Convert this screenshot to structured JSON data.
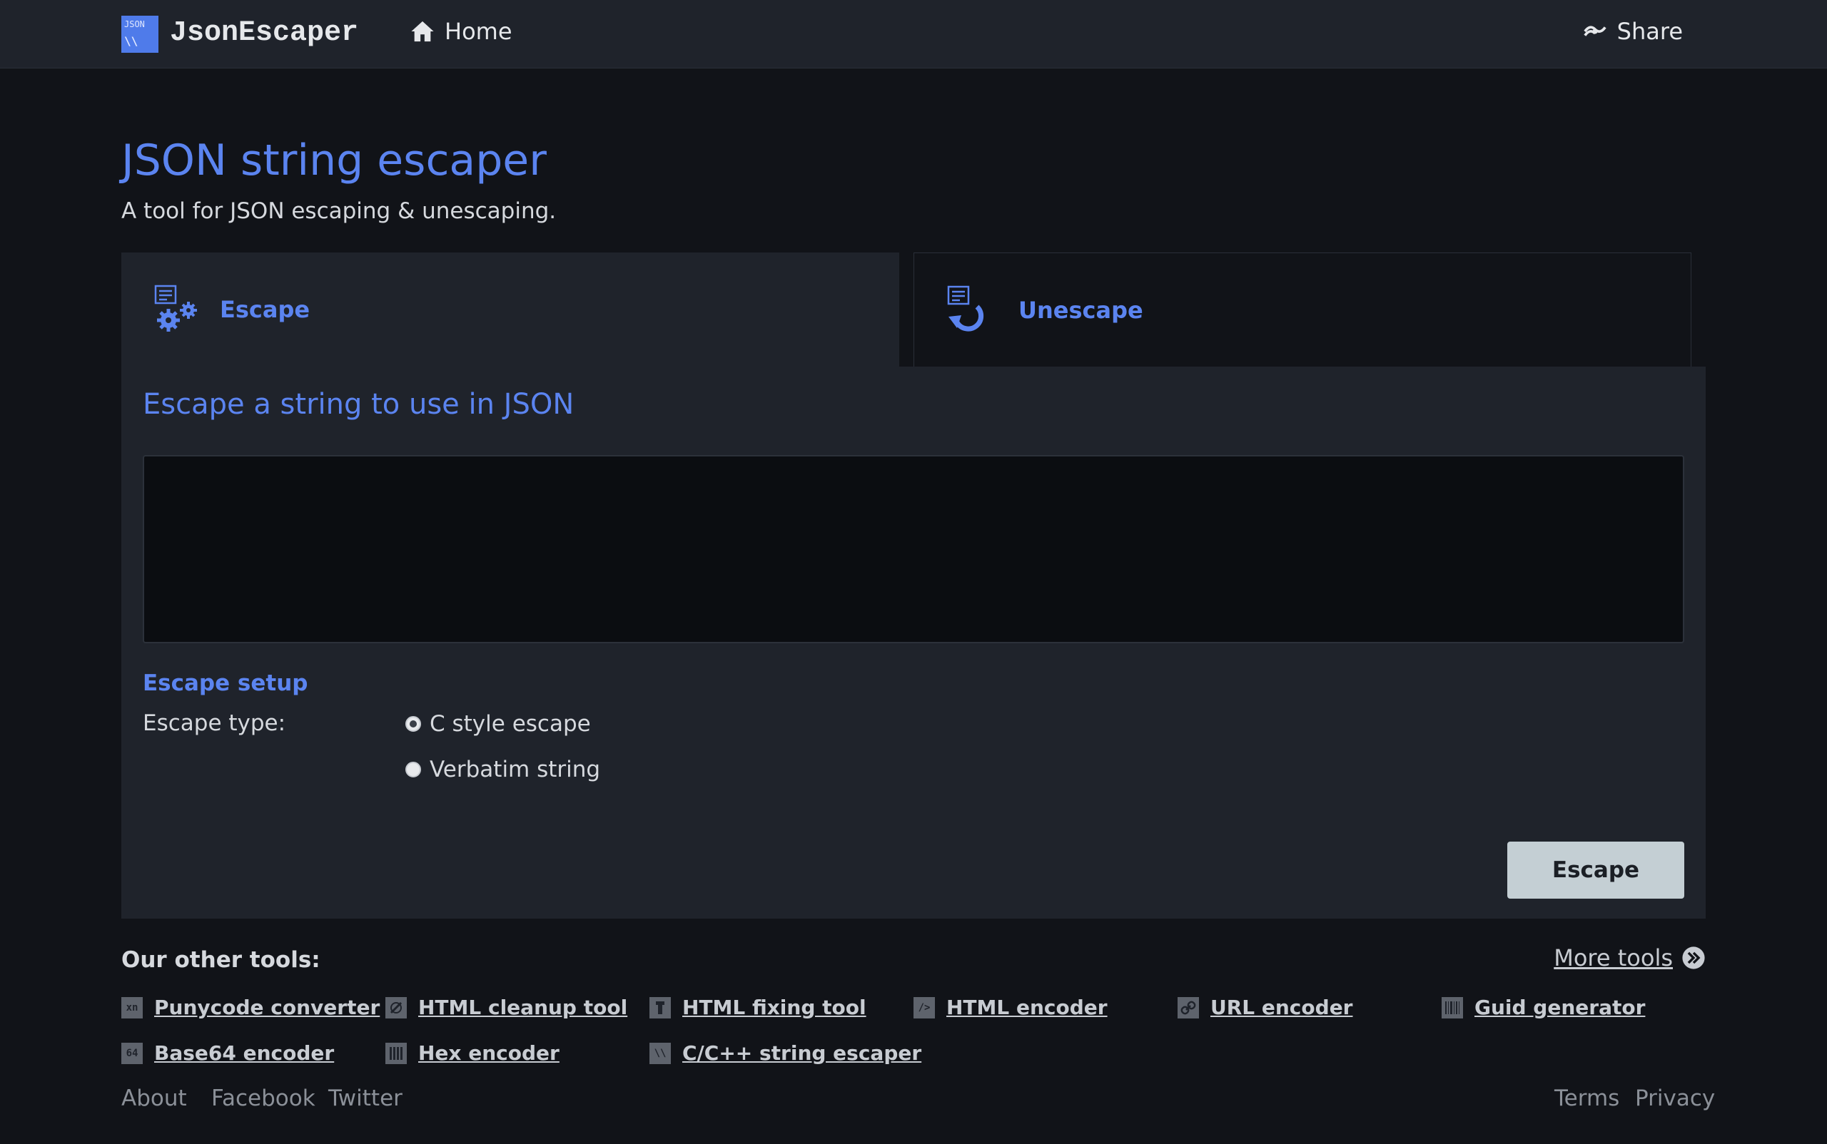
{
  "header": {
    "logo_line1": "JSON",
    "logo_line2": "\\\\",
    "brand": "JsonEscaper",
    "home_label": "Home",
    "share_label": "Share"
  },
  "page": {
    "title": "JSON string escaper",
    "subtitle": "A tool for JSON escaping & unescaping."
  },
  "tabs": [
    {
      "label": "Escape",
      "active": true
    },
    {
      "label": "Unescape",
      "active": false
    }
  ],
  "panel": {
    "title": "Escape a string to use in JSON",
    "input_value": "",
    "setup_title": "Escape setup",
    "type_label": "Escape type:",
    "options": [
      {
        "label": "C style escape",
        "checked": true
      },
      {
        "label": "Verbatim string",
        "checked": false
      }
    ],
    "action_label": "Escape"
  },
  "other_tools": {
    "title": "Our other tools:",
    "more_label": "More tools",
    "items": [
      {
        "label": "Punycode converter",
        "icon": "xn"
      },
      {
        "label": "HTML cleanup tool",
        "icon": ""
      },
      {
        "label": "HTML fixing tool",
        "icon": ""
      },
      {
        "label": "HTML encoder",
        "icon": "/>"
      },
      {
        "label": "URL encoder",
        "icon": ""
      },
      {
        "label": "Guid generator",
        "icon": ""
      },
      {
        "label": "Base64 encoder",
        "icon": "64"
      },
      {
        "label": "Hex encoder",
        "icon": ""
      },
      {
        "label": "C/C++ string escaper",
        "icon": "\\\\"
      }
    ]
  },
  "footer": {
    "about": "About",
    "facebook": "Facebook",
    "twitter": "Twitter",
    "terms": "Terms",
    "privacy": "Privacy"
  },
  "colors": {
    "accent": "#5b84f0",
    "background": "#111318",
    "panel": "#1f232b",
    "button": "#c4cfd4"
  }
}
